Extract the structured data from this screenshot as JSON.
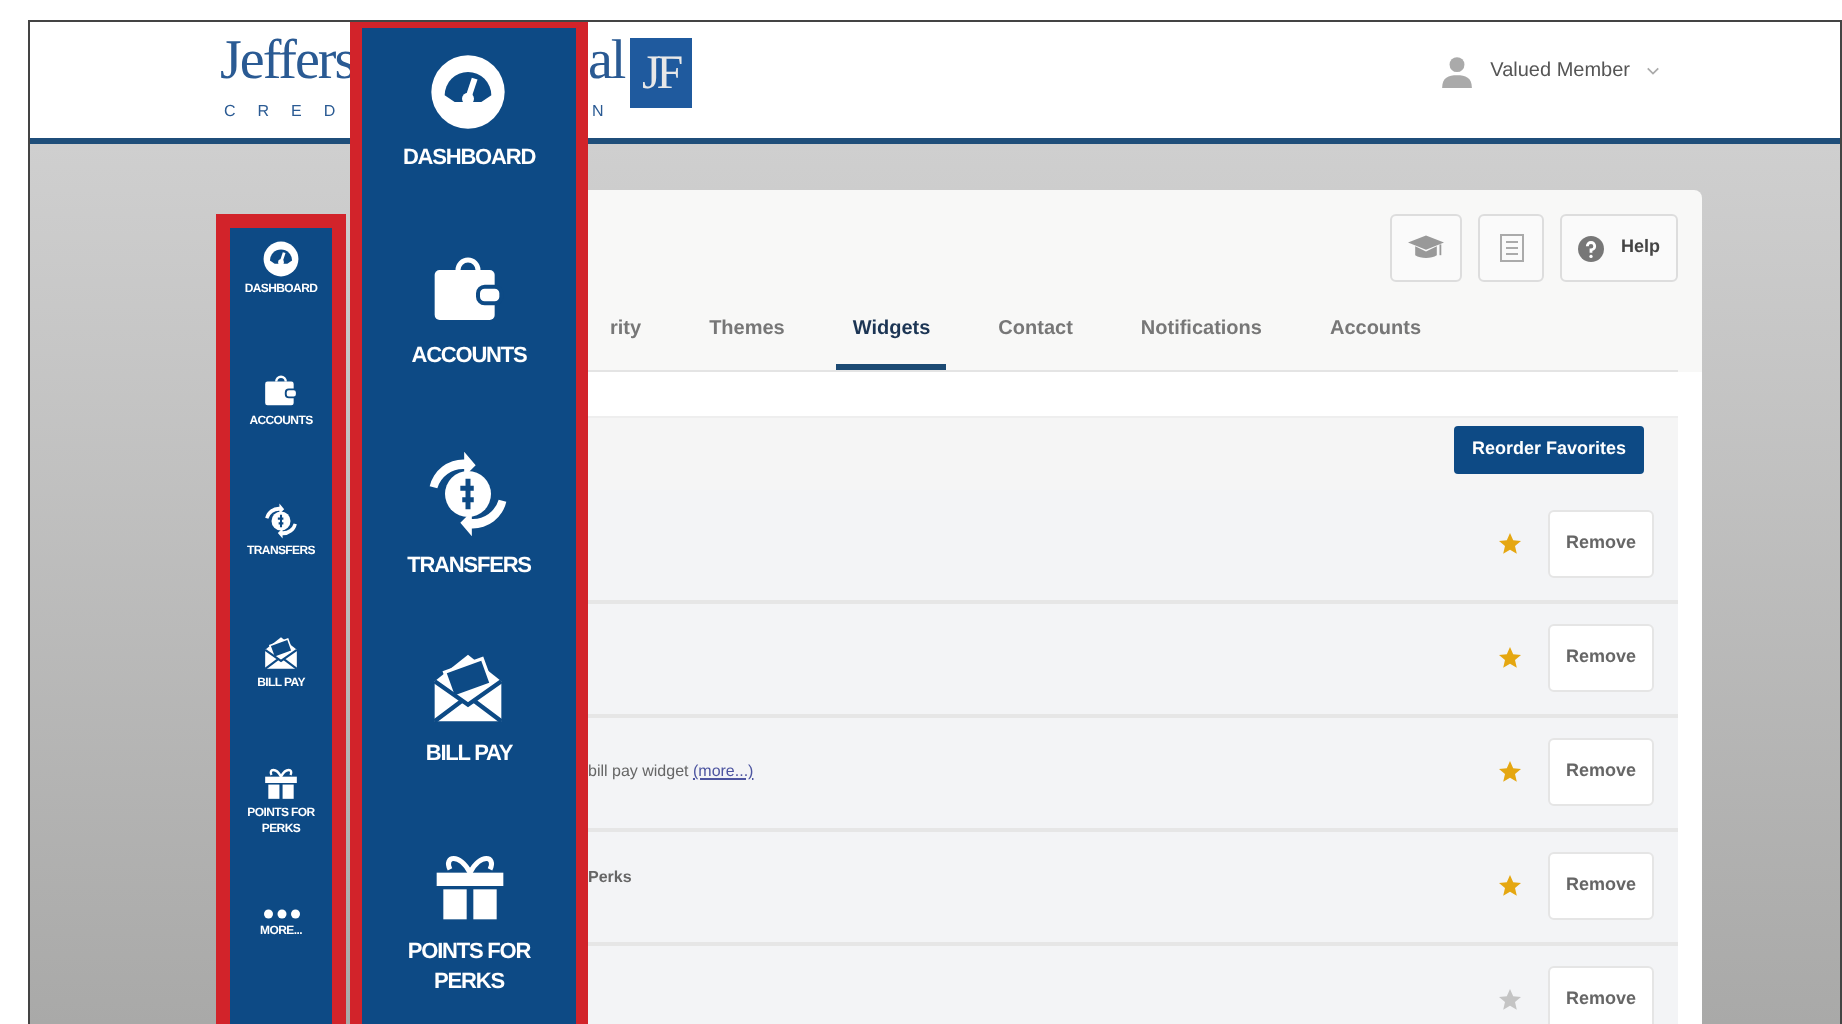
{
  "header": {
    "logo": {
      "word_left": "Jeffers",
      "word_right": "al",
      "sub_left": "CRED",
      "sub_right": "N",
      "mark": "JF"
    },
    "user": {
      "name": "Valued Member"
    }
  },
  "sidebar": {
    "items": [
      {
        "label": "DASHBOARD"
      },
      {
        "label": "ACCOUNTS"
      },
      {
        "label": "TRANSFERS"
      },
      {
        "label": "BILL PAY"
      },
      {
        "label": "POINTS FOR PERKS"
      },
      {
        "label": "MORE..."
      }
    ]
  },
  "toolbar": {
    "help_label": "Help"
  },
  "tabs": [
    {
      "label": "rity",
      "selected": false
    },
    {
      "label": "Themes",
      "selected": false
    },
    {
      "label": "Widgets",
      "selected": true
    },
    {
      "label": "Contact",
      "selected": false
    },
    {
      "label": "Notifications",
      "selected": false
    },
    {
      "label": "Accounts",
      "selected": false
    }
  ],
  "widgets": {
    "reorder_label": "Reorder Favorites",
    "rows": [
      {
        "favorite": true,
        "remove_label": "Remove"
      },
      {
        "favorite": true,
        "remove_label": "Remove"
      },
      {
        "description": "bill pay widget",
        "more": "(more...)",
        "favorite": true,
        "remove_label": "Remove"
      },
      {
        "title": "Perks",
        "favorite": true,
        "remove_label": "Remove"
      },
      {
        "favorite": false,
        "remove_label": "Remove"
      }
    ]
  },
  "callout": {
    "items": [
      {
        "label": "DASHBOARD"
      },
      {
        "label": "ACCOUNTS"
      },
      {
        "label": "TRANSFERS"
      },
      {
        "label": "BILL PAY"
      },
      {
        "label": "POINTS FOR PERKS"
      }
    ]
  }
}
